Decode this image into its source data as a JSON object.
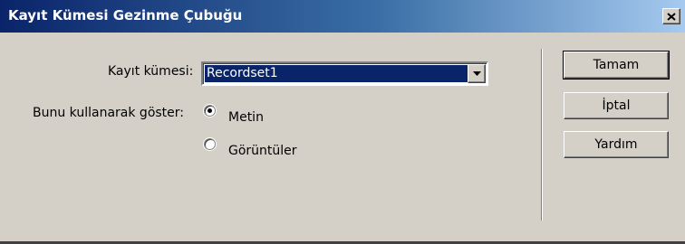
{
  "window": {
    "title": "Kayıt Kümesi Gezinme Çubuğu",
    "close_icon": "close-icon"
  },
  "form": {
    "recordset_label": "Kayıt kümesi:",
    "recordset_value": "Recordset1",
    "display_label": "Bunu kullanarak göster:",
    "options": [
      {
        "label": "Metin",
        "selected": true
      },
      {
        "label": "Görüntüler",
        "selected": false
      }
    ]
  },
  "buttons": {
    "ok": "Tamam",
    "cancel": "İptal",
    "help": "Yardım"
  },
  "colors": {
    "title_bar_start": "#0a246a",
    "title_bar_end": "#a6caf0",
    "selection": "#0a246a",
    "face": "#d4d0c8"
  }
}
